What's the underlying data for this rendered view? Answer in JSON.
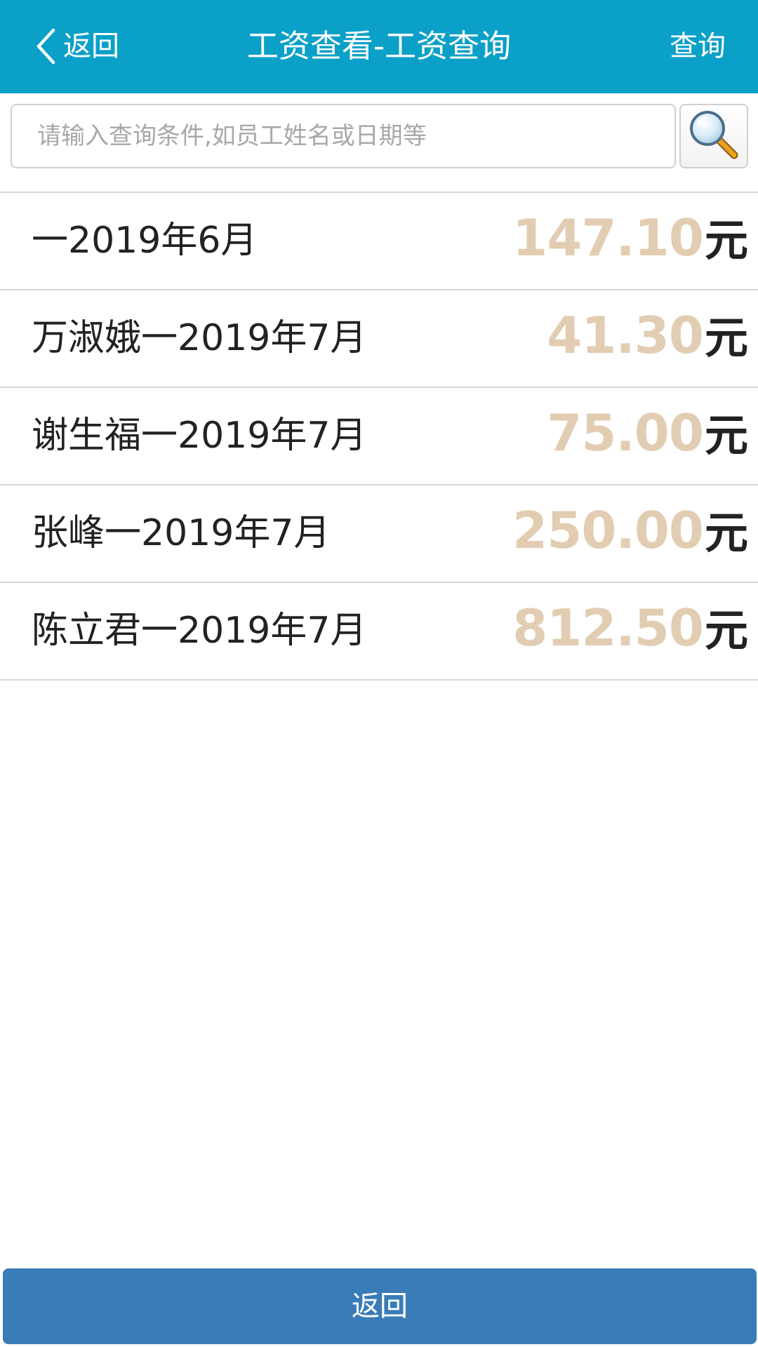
{
  "header": {
    "back_label": "返回",
    "title": "工资查看-工资查询",
    "query_label": "查询",
    "background_color": "#0aa0c8"
  },
  "search": {
    "placeholder": "请输入查询条件,如员工姓名或日期等",
    "value": "",
    "button_icon": "magnifier-icon"
  },
  "records": [
    {
      "label": "一2019年6月",
      "amount": "147.10",
      "unit": "元"
    },
    {
      "label": "万淑娥一2019年7月",
      "amount": "41.30",
      "unit": "元"
    },
    {
      "label": "谢生福一2019年7月",
      "amount": "75.00",
      "unit": "元"
    },
    {
      "label": "张峰一2019年7月",
      "amount": "250.00",
      "unit": "元"
    },
    {
      "label": "陈立君一2019年7月",
      "amount": "812.50",
      "unit": "元"
    }
  ],
  "footer": {
    "back_button_label": "返回",
    "button_color": "#3a7cb7"
  },
  "colors": {
    "amount": "#e2cdb3",
    "text": "#222222",
    "divider": "#d6d6d6"
  }
}
